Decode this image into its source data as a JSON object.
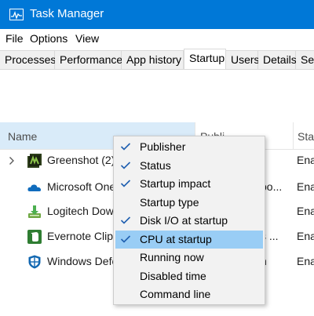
{
  "window": {
    "title": "Task Manager",
    "accent": "#0078d7"
  },
  "menubar": {
    "file": "File",
    "options": "Options",
    "view": "View"
  },
  "tabs": [
    "Processes",
    "Performance",
    "App history",
    "Startup",
    "Users",
    "Details",
    "Ser"
  ],
  "active_tab": "Startup",
  "columns": {
    "name": "Name",
    "publisher": "Publi",
    "status": "Sta"
  },
  "rows": [
    {
      "name": "Greenshot (2)",
      "publisher": "",
      "status": "Ena",
      "icon": "greenshot-icon",
      "expandable": true
    },
    {
      "name": "Microsoft One",
      "publisher": "po...",
      "status": "Ena",
      "icon": "onedrive-icon",
      "expandable": false
    },
    {
      "name": "Logitech Dow",
      "publisher": "",
      "status": "Ena",
      "icon": "logitech-download-icon",
      "expandable": false
    },
    {
      "name": "Evernote Clipp",
      "publisher": "s ...",
      "status": "Ena",
      "icon": "evernote-icon",
      "expandable": false
    },
    {
      "name": "Windows Defe",
      "publisher": "n",
      "status": "Ena",
      "icon": "windows-defender-icon",
      "expandable": false
    }
  ],
  "context_menu": {
    "items": [
      {
        "label": "Publisher",
        "checked": true
      },
      {
        "label": "Status",
        "checked": true
      },
      {
        "label": "Startup impact",
        "checked": true
      },
      {
        "label": "Startup type",
        "checked": false
      },
      {
        "label": "Disk I/O at startup",
        "checked": true
      },
      {
        "label": "CPU at startup",
        "checked": true,
        "highlighted": true
      },
      {
        "label": "Running now",
        "checked": false
      },
      {
        "label": "Disabled time",
        "checked": false
      },
      {
        "label": "Command line",
        "checked": false
      }
    ],
    "highlight_color": "#99cdf5"
  }
}
